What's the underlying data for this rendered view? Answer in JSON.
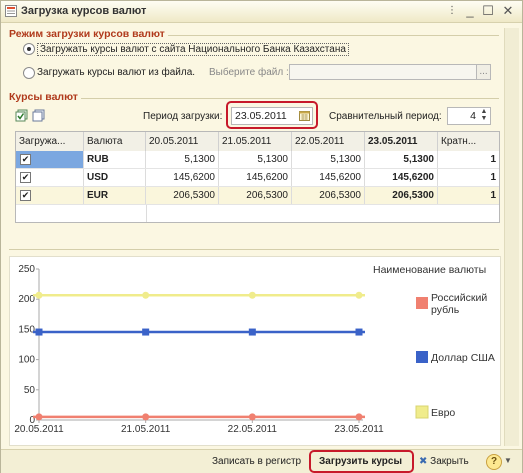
{
  "window": {
    "title": "Загрузка курсов валют"
  },
  "mode_group": {
    "title": "Режим загрузки курсов валют",
    "option_site": "Загружать курсы валют с сайта Национального Банка Казахстана",
    "option_file": "Загружать курсы валют из файла.",
    "file_label": "Выберите файл :",
    "browse": "..."
  },
  "rates_group": {
    "title": "Курсы валют",
    "period_label": "Период загрузки:",
    "period_value": "23.05.2011",
    "compare_label": "Сравнительный период:",
    "compare_value": "4"
  },
  "table": {
    "headers": [
      "Загружа...",
      "Валюта",
      "20.05.2011",
      "21.05.2011",
      "22.05.2011",
      "23.05.2011",
      "Кратн..."
    ],
    "rows": [
      {
        "currency": "RUB",
        "v1": "5,1300",
        "v2": "5,1300",
        "v3": "5,1300",
        "v4": "5,1300",
        "mult": "1"
      },
      {
        "currency": "USD",
        "v1": "145,6200",
        "v2": "145,6200",
        "v3": "145,6200",
        "v4": "145,6200",
        "mult": "1"
      },
      {
        "currency": "EUR",
        "v1": "206,5300",
        "v2": "206,5300",
        "v3": "206,5300",
        "v4": "206,5300",
        "mult": "1"
      }
    ]
  },
  "chart_data": {
    "type": "line",
    "categories": [
      "20.05.2011",
      "21.05.2011",
      "22.05.2011",
      "23.05.2011"
    ],
    "series": [
      {
        "name": "Российский рубль",
        "values": [
          5.13,
          5.13,
          5.13,
          5.13
        ],
        "color": "#f08070"
      },
      {
        "name": "Доллар США",
        "values": [
          145.62,
          145.62,
          145.62,
          145.62
        ],
        "color": "#3a62c8"
      },
      {
        "name": "Евро",
        "values": [
          206.53,
          206.53,
          206.53,
          206.53
        ],
        "color": "#f0ec8c"
      }
    ],
    "ylim": [
      0,
      250
    ],
    "yticks": [
      "250",
      "200",
      "150",
      "100",
      "50",
      "0"
    ],
    "legend_title": "Наименование валюты",
    "legend_position": "right",
    "grid": false
  },
  "footer": {
    "write_label": "Записать в регистр",
    "load_label": "Загрузить курсы",
    "close_label": "Закрыть",
    "help": "?"
  },
  "colors": {
    "accent": "#b03a1c",
    "highlight": "#c7192a",
    "row_selected": "#7ba7e0"
  }
}
